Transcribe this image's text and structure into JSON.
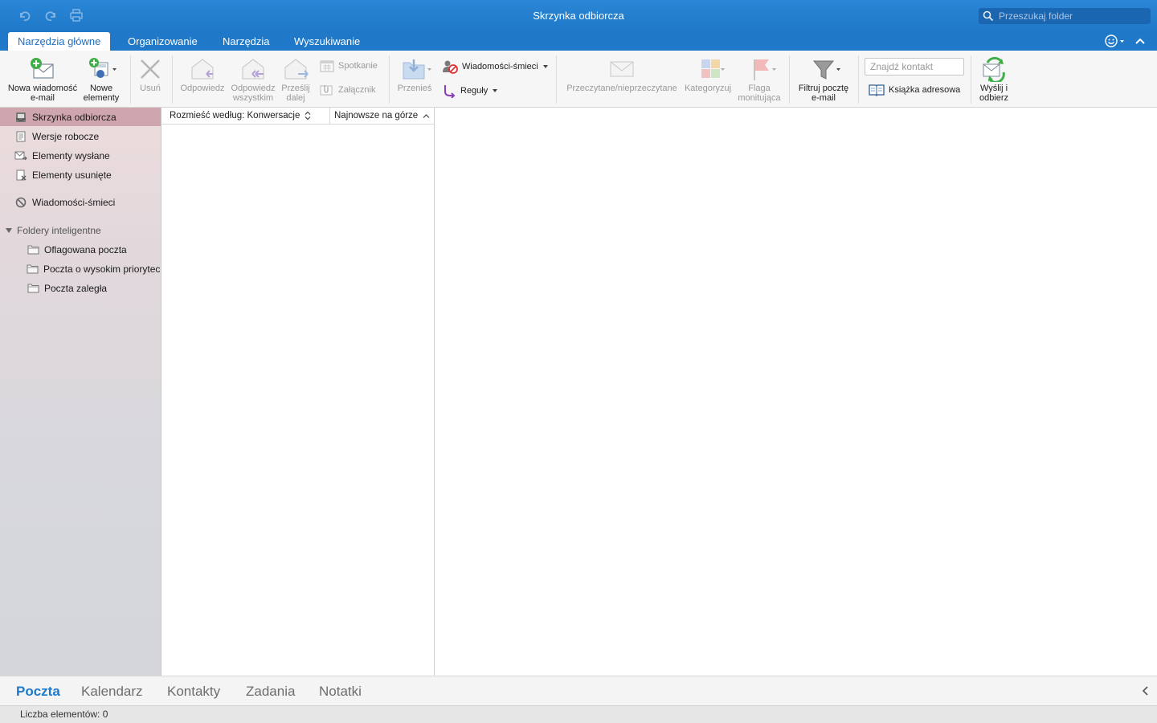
{
  "window": {
    "title": "Skrzynka odbiorcza",
    "search_placeholder": "Przeszukaj folder"
  },
  "tabs": [
    {
      "label": "Narzędzia główne",
      "active": true
    },
    {
      "label": "Organizowanie"
    },
    {
      "label": "Narzędzia"
    },
    {
      "label": "Wyszukiwanie"
    }
  ],
  "ribbon": {
    "new_email": [
      "Nowa wiadomość",
      "e-mail"
    ],
    "new_items": [
      "Nowe",
      "elementy"
    ],
    "delete": "Usuń",
    "reply": "Odpowiedz",
    "reply_all": [
      "Odpowiedz",
      "wszystkim"
    ],
    "forward": [
      "Prześlij",
      "dalej"
    ],
    "meeting": "Spotkanie",
    "attachment": "Załącznik",
    "move": "Przenieś",
    "junk": "Wiadomości-śmieci",
    "rules": "Reguły",
    "read_unread": "Przeczytane/nieprzeczytane",
    "categorize": "Kategoryzuj",
    "follow_up": [
      "Flaga",
      "monitująca"
    ],
    "filter": [
      "Filtruj pocztę",
      "e-mail"
    ],
    "find_contact_placeholder": "Znajdź kontakt",
    "address_book": "Książka adresowa",
    "send_receive": [
      "Wyślij i",
      "odbierz"
    ]
  },
  "sidebar": {
    "folders": [
      {
        "label": "Skrzynka odbiorcza",
        "icon": "inbox-icon",
        "selected": true
      },
      {
        "label": "Wersje robocze",
        "icon": "drafts-icon"
      },
      {
        "label": "Elementy wysłane",
        "icon": "sent-icon"
      },
      {
        "label": "Elementy usunięte",
        "icon": "trash-icon"
      },
      {
        "label": "Wiadomości-śmieci",
        "icon": "junk-icon"
      }
    ],
    "smart_header": "Foldery inteligentne",
    "smart_folders": [
      {
        "label": "Oflagowana poczta",
        "icon": "folder-icon"
      },
      {
        "label": "Poczta o wysokim priorytecie",
        "icon": "folder-icon"
      },
      {
        "label": "Poczta zaległa",
        "icon": "folder-icon"
      }
    ]
  },
  "message_list": {
    "sort_label": "Rozmieść według: Konwersacje",
    "order_label": "Najnowsze na górze"
  },
  "bottom_nav": [
    {
      "label": "Poczta",
      "active": true
    },
    {
      "label": "Kalendarz"
    },
    {
      "label": "Kontakty"
    },
    {
      "label": "Zadania"
    },
    {
      "label": "Notatki"
    }
  ],
  "status": "Liczba elementów: 0",
  "colors": {
    "accent": "#1f78c8",
    "selected_folder": "#cfa6ae"
  }
}
